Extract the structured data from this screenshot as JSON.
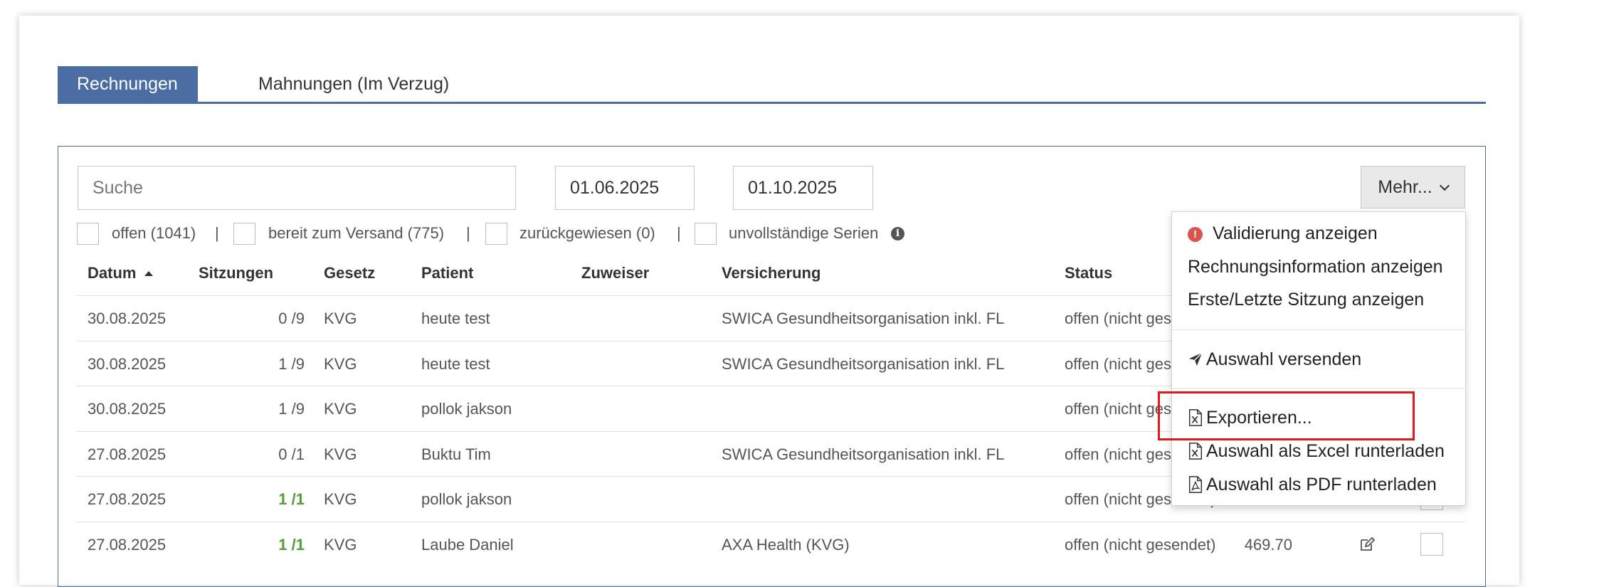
{
  "tabs": [
    {
      "label": "Rechnungen",
      "active": true
    },
    {
      "label": "Mahnungen (Im Verzug)",
      "active": false
    }
  ],
  "search": {
    "placeholder": "Suche",
    "value": ""
  },
  "date_from": "01.06.2025",
  "date_to": "01.10.2025",
  "more_button": {
    "label": "Mehr..."
  },
  "filters": [
    {
      "label": "offen (1041)"
    },
    {
      "label": "bereit zum Versand (775)"
    },
    {
      "label": "zurückgewiesen (0)"
    },
    {
      "label": "unvollständige Serien"
    }
  ],
  "filter_separator": "|",
  "columns": {
    "datum": "Datum",
    "sitzungen": "Sitzungen",
    "gesetz": "Gesetz",
    "patient": "Patient",
    "zuweiser": "Zuweiser",
    "versicherung": "Versicherung",
    "status": "Status"
  },
  "rows": [
    {
      "datum": "30.08.2025",
      "sitzungen": "0 /9",
      "sitzungen_complete": false,
      "gesetz": "KVG",
      "patient": "heute test",
      "zuweiser": "",
      "versicherung": "SWICA Gesundheitsorganisation inkl. FL",
      "status": "offen (nicht gesendet)",
      "betrag": ""
    },
    {
      "datum": "30.08.2025",
      "sitzungen": "1 /9",
      "sitzungen_complete": false,
      "gesetz": "KVG",
      "patient": "heute test",
      "zuweiser": "",
      "versicherung": "SWICA Gesundheitsorganisation inkl. FL",
      "status": "offen (nicht gesendet)",
      "betrag": ""
    },
    {
      "datum": "30.08.2025",
      "sitzungen": "1 /9",
      "sitzungen_complete": false,
      "gesetz": "KVG",
      "patient": "pollok jakson",
      "zuweiser": "",
      "versicherung": "",
      "status": "offen (nicht gesendet)",
      "betrag": ""
    },
    {
      "datum": "27.08.2025",
      "sitzungen": "0 /1",
      "sitzungen_complete": false,
      "gesetz": "KVG",
      "patient": "Buktu Tim",
      "zuweiser": "",
      "versicherung": "SWICA Gesundheitsorganisation inkl. FL",
      "status": "offen (nicht gesendet)",
      "betrag": ""
    },
    {
      "datum": "27.08.2025",
      "sitzungen": "1 /1",
      "sitzungen_complete": true,
      "gesetz": "KVG",
      "patient": "pollok jakson",
      "zuweiser": "",
      "versicherung": "",
      "status": "offen (nicht gesendet)",
      "betrag": ""
    },
    {
      "datum": "27.08.2025",
      "sitzungen": "1 /1",
      "sitzungen_complete": true,
      "gesetz": "KVG",
      "patient": "Laube Daniel",
      "zuweiser": "",
      "versicherung": "AXA Health (KVG)",
      "status": "offen (nicht gesendet)",
      "betrag": "469.70"
    }
  ],
  "menu": {
    "items": [
      {
        "label": "Validierung anzeigen",
        "icon": "alert-circle-icon"
      },
      {
        "label": "Rechnungsinformation anzeigen",
        "icon": ""
      },
      {
        "label": "Erste/Letzte Sitzung anzeigen",
        "icon": ""
      },
      {
        "label": "Auswahl versenden",
        "icon": "paper-plane-icon"
      },
      {
        "label": "Exportieren...",
        "icon": "excel-file-icon"
      },
      {
        "label": "Auswahl als Excel runterladen",
        "icon": "excel-file-icon"
      },
      {
        "label": "Auswahl als PDF runterladen",
        "icon": "pdf-file-icon"
      }
    ],
    "highlighted": "Exportieren..."
  },
  "colors": {
    "accent": "#4b6da4",
    "complete": "#4fa03a",
    "alert": "#d9534f",
    "highlight": "#e01a1a"
  }
}
